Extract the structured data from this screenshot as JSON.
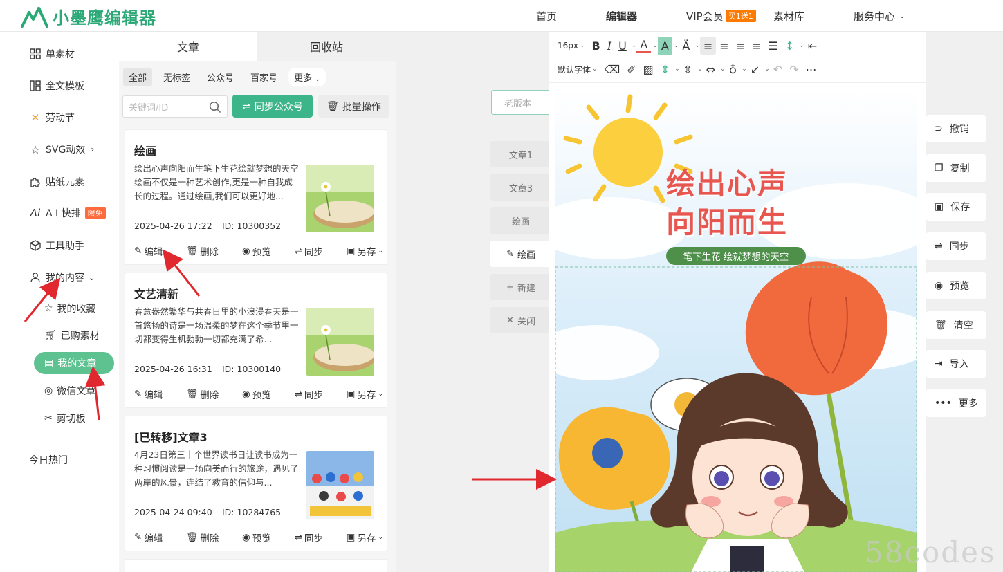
{
  "header": {
    "logo_text": "小墨鹰编辑器",
    "nav": [
      {
        "label": "首页"
      },
      {
        "label": "编辑器"
      },
      {
        "label": "VIP会员"
      },
      {
        "label": "素材库"
      },
      {
        "label": "服务中心"
      }
    ],
    "vip_badge": "买1送1"
  },
  "sidebar": {
    "items": [
      {
        "label": "单素材",
        "icon": "grid-icon"
      },
      {
        "label": "全文模板",
        "icon": "template-icon"
      },
      {
        "label": "劳动节",
        "icon": "tools-icon"
      },
      {
        "label": "SVG动效",
        "icon": "star-icon"
      },
      {
        "label": "贴纸元素",
        "icon": "puzzle-icon"
      },
      {
        "label": "A I 快排",
        "icon": "ai-icon",
        "badge": "限免"
      },
      {
        "label": "工具助手",
        "icon": "cube-icon"
      },
      {
        "label": "我的内容",
        "icon": "user-icon"
      }
    ],
    "sub_items": [
      {
        "label": "我的收藏"
      },
      {
        "label": "已购素材"
      },
      {
        "label": "我的文章"
      },
      {
        "label": "微信文章"
      },
      {
        "label": "剪切板"
      }
    ],
    "hot": "今日热门"
  },
  "panel": {
    "tabs": [
      "文章",
      "回收站"
    ],
    "filters": [
      "全部",
      "无标签",
      "公众号",
      "百家号",
      "更多"
    ],
    "search_placeholder": "关键词/ID",
    "sync_button": "同步公众号",
    "batch_button": "批量操作",
    "cards": [
      {
        "title": "绘画",
        "desc": "绘出心声向阳而生笔下生花绘就梦想的天空绘画不仅是一种艺术创作,更是一种自我成长的过程。通过绘画,我们可以更好地...",
        "date": "2025-04-26 17:22",
        "id": "ID: 10300352"
      },
      {
        "title": "文艺清新",
        "desc": "春意盎然繁华与共春日里的小浪漫春天是一首悠扬的诗是一场温柔的梦在这个季节里一切都变得生机勃勃一切都充满了希...",
        "date": "2025-04-26 16:31",
        "id": "ID: 10300140"
      },
      {
        "title": "[已转移]文章3",
        "desc": "4月23日第三十个世界读书日让读书成为一种习惯阅读是一场向美而行的旅途，遇见了两岸的风景，连结了教育的信仰与...",
        "date": "2025-04-24 09:40",
        "id": "ID: 10284765"
      }
    ],
    "actions": [
      "编辑",
      "删除",
      "预览",
      "同步",
      "另存"
    ]
  },
  "docs": {
    "old_version": "老版本",
    "list": [
      "文章1",
      "文章3",
      "绘画",
      "绘画"
    ],
    "new": "新建",
    "close": "关闭"
  },
  "toolbar": {
    "font_size": "16px",
    "font_family": "默认字体"
  },
  "canvas": {
    "title_line1": "绘出心声",
    "title_line2": "向阳而生",
    "subtitle": "笔下生花 绘就梦想的天空"
  },
  "rightbar": [
    "撤销",
    "复制",
    "保存",
    "同步",
    "预览",
    "清空",
    "导入",
    "更多"
  ],
  "watermark": "58codes",
  "colors": {
    "brand": "#3db58b",
    "accent_red": "#e8574f",
    "vip_orange": "#ff7a00"
  }
}
